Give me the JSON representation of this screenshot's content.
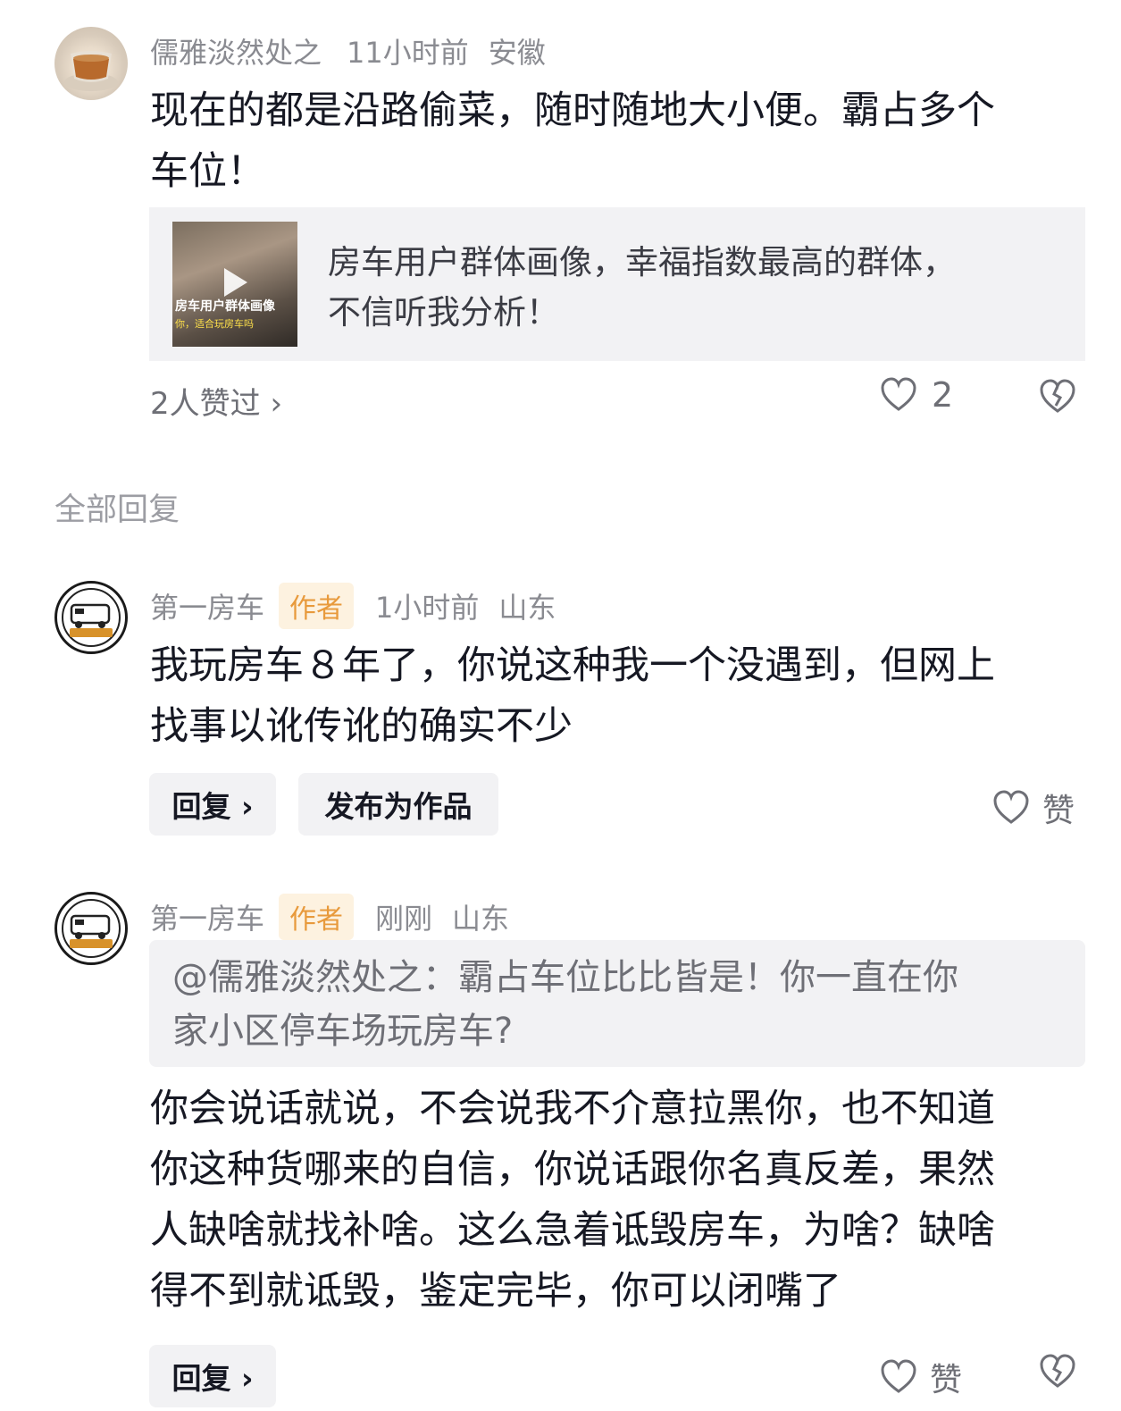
{
  "comment": {
    "user": "儒雅淡然处之",
    "time": "11小时前",
    "location": "安徽",
    "text_line1": "现在的都是沿路偷菜，随时随地大小便。霸占多个",
    "text_line2": "车位！",
    "video": {
      "thumb_caption1": "房车用户群体画像",
      "thumb_caption2": "你，适合玩房车吗",
      "title_line1": "房车用户群体画像，幸福指数最高的群体，",
      "title_line2": "不信听我分析！"
    },
    "likers": "2人赞过 ›",
    "like_count": "2"
  },
  "replies_section_title": "全部回复",
  "replies": [
    {
      "user": "第一房车",
      "tag": "作者",
      "time": "1小时前",
      "location": "山东",
      "text_line1": "我玩房车８年了，你说这种我一个没遇到，但网上",
      "text_line2": "找事以讹传讹的确实不少",
      "reply_label": "回复 ›",
      "publish_label": "发布为作品",
      "like_label": "赞"
    },
    {
      "user": "第一房车",
      "tag": "作者",
      "time": "刚刚",
      "location": "山东",
      "quote_line1": "@儒雅淡然处之：霸占车位比比皆是！你一直在你",
      "quote_line2": "家小区停车场玩房车?",
      "text_line1": "你会说话就说，不会说我不介意拉黑你，也不知道",
      "text_line2": "你这种货哪来的自信，你说话跟你名真反差，果然",
      "text_line3": "人缺啥就找补啥。这么急着诋毁房车，为啥？缺啥",
      "text_line4": "得不到就诋毁，鉴定完毕，你可以闭嘴了",
      "reply_label": "回复 ›",
      "like_label": "赞"
    }
  ],
  "icons": {
    "heart": "heart-icon",
    "dislike": "broken-heart-icon",
    "play": "play-icon"
  },
  "colors": {
    "tag_bg": "#fdf2e0",
    "tag_text": "#e89a3c",
    "muted": "#8a8b91",
    "card_bg": "#f2f2f4"
  }
}
